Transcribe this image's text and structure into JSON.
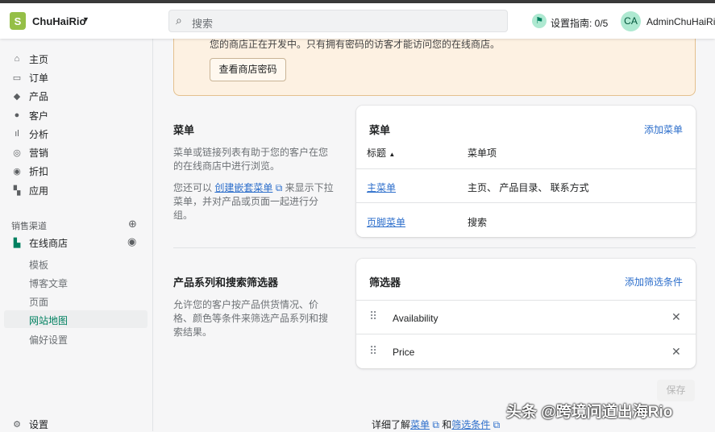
{
  "header": {
    "store_name": "ChuHaiRio",
    "search_placeholder": "搜索",
    "setup_guide": "设置指南: 0/5",
    "avatar_initials": "CA",
    "admin_name": "AdminChuHaiRio"
  },
  "sidebar": {
    "items": [
      {
        "label": "主页",
        "icon": "home-icon"
      },
      {
        "label": "订单",
        "icon": "orders-icon"
      },
      {
        "label": "产品",
        "icon": "tag-icon"
      },
      {
        "label": "客户",
        "icon": "person-icon"
      },
      {
        "label": "分析",
        "icon": "bar-chart-icon"
      },
      {
        "label": "营销",
        "icon": "marketing-icon"
      },
      {
        "label": "折扣",
        "icon": "discount-icon"
      },
      {
        "label": "应用",
        "icon": "apps-icon"
      }
    ],
    "channels_label": "销售渠道",
    "online_store": "在线商店",
    "sub_items": [
      "模板",
      "博客文章",
      "页面",
      "网站地图",
      "偏好设置"
    ],
    "active_sub": "网站地图",
    "settings": "设置"
  },
  "banner": {
    "text": "您的商店正在开发中。只有拥有密码的访客才能访问您的在线商店。",
    "button": "查看商店密码"
  },
  "menus": {
    "title": "菜单",
    "desc": "菜单或链接列表有助于您的客户在您的在线商店中进行浏览。",
    "desc2_prefix": "您还可以 ",
    "desc2_link": "创建嵌套菜单",
    "desc2_suffix": " 来显示下拉菜单，并对产品或页面一起进行分组。",
    "card_title": "菜单",
    "add": "添加菜单",
    "col_title": "标题",
    "col_items": "菜单项",
    "rows": [
      {
        "title": "主菜单",
        "items": "主页、 产品目录、 联系方式"
      },
      {
        "title": "页脚菜单",
        "items": "搜索"
      }
    ]
  },
  "filters": {
    "title": "产品系列和搜索筛选器",
    "desc": "允许您的客户按产品供货情况、价格、颜色等条件来筛选产品系列和搜索结果。",
    "card_title": "筛选器",
    "add": "添加筛选条件",
    "rows": [
      "Availability",
      "Price"
    ]
  },
  "save": "保存",
  "footer": {
    "prefix": "详细了解",
    "link1": "菜单",
    "mid": " 和",
    "link2": "筛选条件"
  },
  "watermark": "头条 @跨境问道出海Rio",
  "colors": {
    "accent": "#2c6ecb",
    "green": "#008060"
  }
}
